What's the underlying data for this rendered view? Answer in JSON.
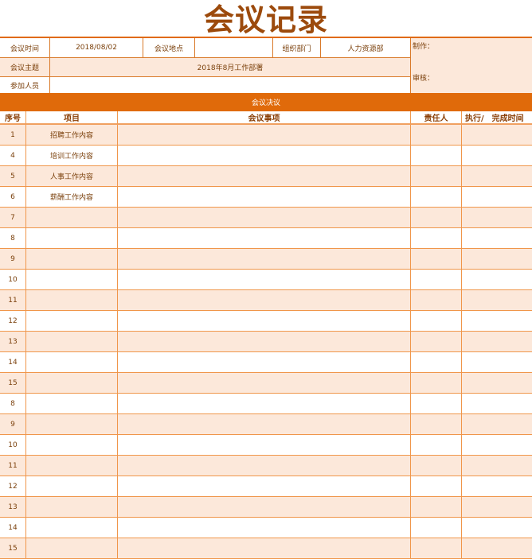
{
  "title": "会议记录",
  "info": {
    "meeting_time_label": "会议时间",
    "meeting_time_value": "2018/08/02",
    "meeting_place_label": "会议地点",
    "meeting_place_value": "",
    "org_dept_label": "组织部门",
    "org_dept_value": "人力资源部",
    "topic_label": "会议主题",
    "topic_value": "2018年8月工作部署",
    "attendees_label": "参加人员",
    "attendees_value": "",
    "made_by_label": "制作：",
    "reviewed_by_label": "审核："
  },
  "section_title": "会议决议",
  "columns": [
    "序号",
    "项目",
    "会议事项",
    "责任人",
    "执行/　完成时间"
  ],
  "rows": [
    {
      "no": "1",
      "item": "招聘工作内容"
    },
    {
      "no": "4",
      "item": "培训工作内容"
    },
    {
      "no": "5",
      "item": "人事工作内容"
    },
    {
      "no": "6",
      "item": "薪酬工作内容"
    },
    {
      "no": "7",
      "item": ""
    },
    {
      "no": "8",
      "item": ""
    },
    {
      "no": "9",
      "item": ""
    },
    {
      "no": "10",
      "item": ""
    },
    {
      "no": "11",
      "item": ""
    },
    {
      "no": "12",
      "item": ""
    },
    {
      "no": "13",
      "item": ""
    },
    {
      "no": "14",
      "item": ""
    },
    {
      "no": "15",
      "item": ""
    },
    {
      "no": "8",
      "item": ""
    },
    {
      "no": "9",
      "item": ""
    },
    {
      "no": "10",
      "item": ""
    },
    {
      "no": "11",
      "item": ""
    },
    {
      "no": "12",
      "item": ""
    },
    {
      "no": "13",
      "item": ""
    },
    {
      "no": "14",
      "item": ""
    },
    {
      "no": "15",
      "item": ""
    }
  ],
  "colors": {
    "accent": "#e06a0a",
    "title_text": "#9c4a0c",
    "row_peach": "#fce8da",
    "grid_line": "#f0964a"
  }
}
